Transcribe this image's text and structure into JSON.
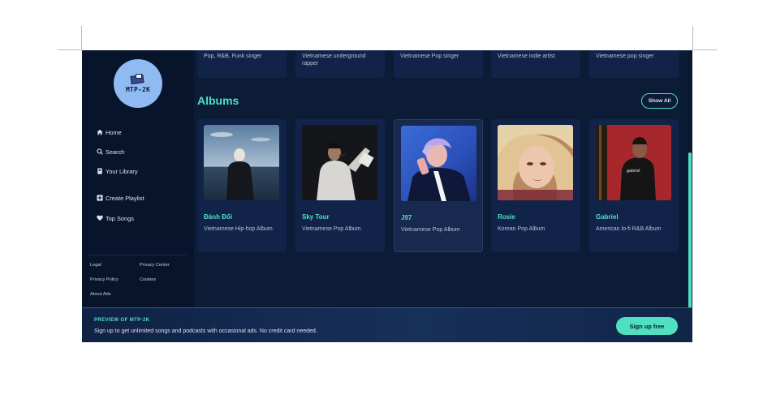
{
  "app": {
    "logo_text": "MTP-2K"
  },
  "sidebar": {
    "nav": [
      {
        "label": "Home",
        "icon": "home-icon"
      },
      {
        "label": "Search",
        "icon": "search-icon"
      },
      {
        "label": "Your Library",
        "icon": "library-icon"
      },
      {
        "label": "Create Playlist",
        "icon": "plus-square-icon"
      },
      {
        "label": "Top Songs",
        "icon": "heart-icon"
      }
    ],
    "footer_links": [
      "Legal",
      "Privacy Center",
      "Privacy Policy",
      "Cookies",
      "About Ads"
    ]
  },
  "artists": [
    {
      "desc": "Pop, R&B, Funk singer"
    },
    {
      "desc": "Vietnamese underground rapper"
    },
    {
      "desc": "Vietnamese Pop singer"
    },
    {
      "desc": "Vietnamese indie artist"
    },
    {
      "desc": "Vietnamese pop singer"
    }
  ],
  "albums_section": {
    "title": "Albums",
    "show_all": "Show All",
    "items": [
      {
        "name": "Đánh Đổi",
        "desc": "Vietnamese Hip-hop Album"
      },
      {
        "name": "Sky Tour",
        "desc": "Vietnamese Pop Album"
      },
      {
        "name": "J97",
        "desc": "Vietnamese Pop Album"
      },
      {
        "name": "Rosie",
        "desc": "Korean Pop Album"
      },
      {
        "name": "Gabriel",
        "desc": "American lo-fi R&B Album"
      }
    ]
  },
  "banner": {
    "title": "PREVIEW OF MTP-2K",
    "text": "Sign up to get unlimited songs and podcasts with occasional ads. No credit card needed.",
    "button": "Sign up free"
  },
  "colors": {
    "accent": "#4fe0c2",
    "background": "#0c1b36",
    "sidebar": "#08142b",
    "card": "#12234a"
  }
}
